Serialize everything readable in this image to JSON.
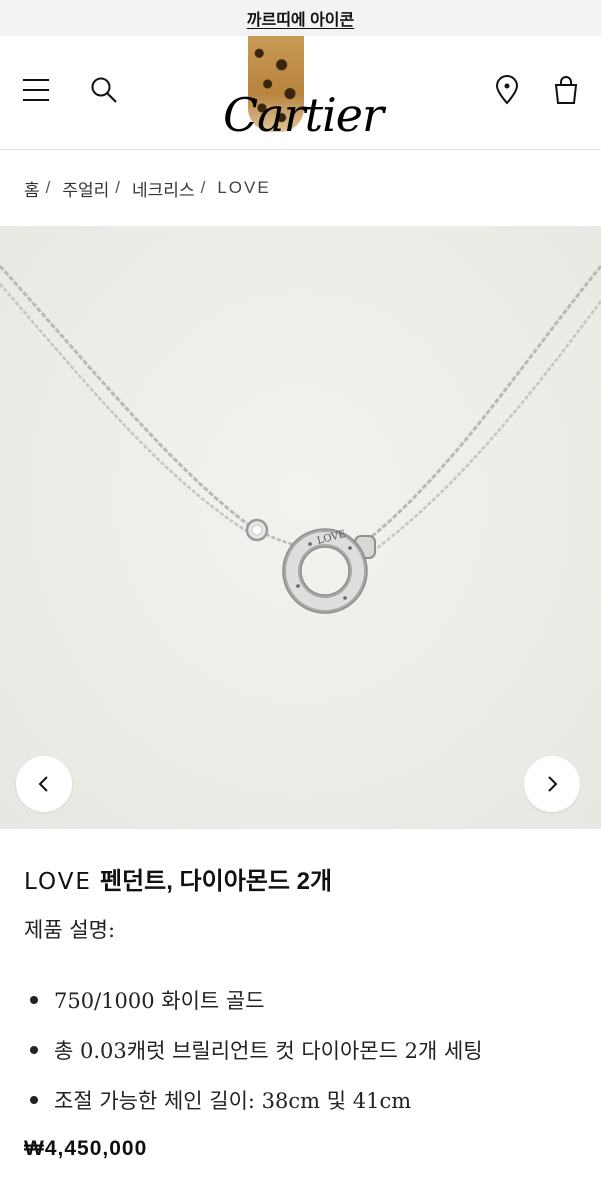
{
  "banner": {
    "text": "까르띠에 아이콘"
  },
  "header": {
    "logo_text": "Cartier",
    "icons": {
      "menu": "hamburger-menu-icon",
      "search": "search-icon",
      "store": "location-pin-icon",
      "bag": "shopping-bag-icon"
    }
  },
  "breadcrumb": {
    "items": [
      "홈",
      "주얼리",
      "네크리스"
    ],
    "separator": "/",
    "current": "LOVE"
  },
  "gallery": {
    "prev_icon": "chevron-left-icon",
    "next_icon": "chevron-right-icon",
    "pendant_engraving": "LOVE"
  },
  "product": {
    "title_brand": "LOVE",
    "title_rest": "펜던트, 다이아몬드 2개",
    "desc_heading": "제품 설명:",
    "features": [
      "750/1000 화이트 골드",
      "총 0.03캐럿 브릴리언트 컷 다이아몬드 2개 세팅",
      "조절 가능한 체인 길이: 38cm 및 41cm"
    ],
    "price": "₩4,450,000"
  }
}
